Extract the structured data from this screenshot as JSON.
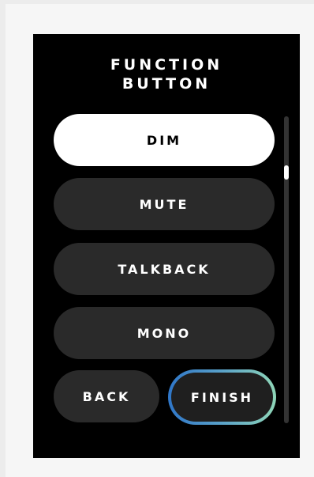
{
  "title": {
    "line1": "FUNCTION",
    "line2": "BUTTON"
  },
  "options": [
    {
      "label": "DIM",
      "selected": true
    },
    {
      "label": "MUTE",
      "selected": false
    },
    {
      "label": "TALKBACK",
      "selected": false
    },
    {
      "label": "MONO",
      "selected": false
    }
  ],
  "nav": {
    "back_label": "BACK",
    "finish_label": "FINISH"
  },
  "colors": {
    "background": "#000000",
    "selected_option": "#ffffff",
    "option": "#2a2a2a",
    "finish_gradient_start": "#2f76c8",
    "finish_gradient_end": "#8fd6b8"
  }
}
